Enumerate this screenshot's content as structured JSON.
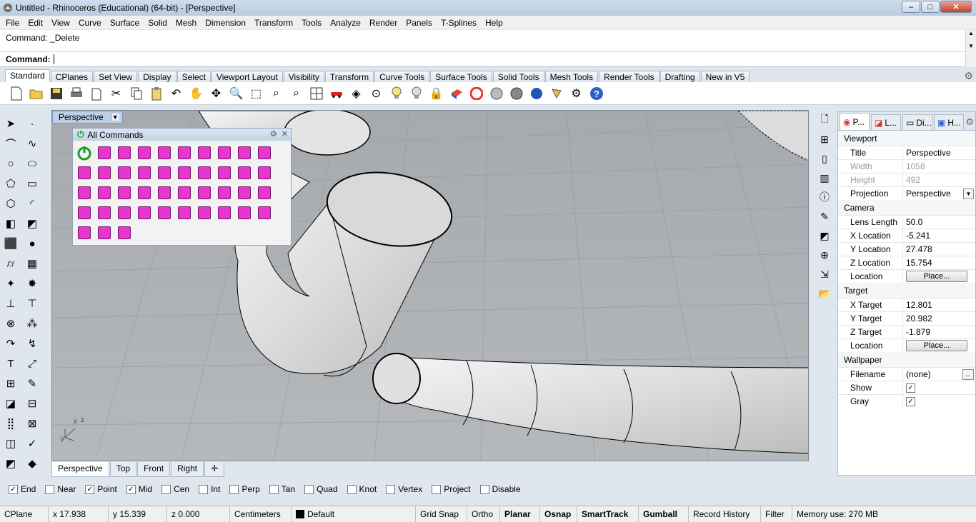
{
  "window": {
    "title": "Untitled - Rhinoceros (Educational) (64-bit) - [Perspective]",
    "min_label": "–",
    "max_label": "□",
    "close_label": "✕"
  },
  "menu": [
    "File",
    "Edit",
    "View",
    "Curve",
    "Surface",
    "Solid",
    "Mesh",
    "Dimension",
    "Transform",
    "Tools",
    "Analyze",
    "Render",
    "Panels",
    "T-Splines",
    "Help"
  ],
  "command": {
    "history": "Command: _Delete",
    "prompt": "Command:",
    "input_value": ""
  },
  "toolbar_tabs": [
    "Standard",
    "CPlanes",
    "Set View",
    "Display",
    "Select",
    "Viewport Layout",
    "Visibility",
    "Transform",
    "Curve Tools",
    "Surface Tools",
    "Solid Tools",
    "Mesh Tools",
    "Render Tools",
    "Drafting",
    "New in V5"
  ],
  "toolbar_icons": [
    "new-file-icon",
    "open-file-icon",
    "save-icon",
    "print-icon",
    "import-icon",
    "cut-icon",
    "copy-icon",
    "paste-icon",
    "undo-icon",
    "pan-hand-icon",
    "rotate-view-icon",
    "zoom-icon",
    "zoom-window-icon",
    "zoom-extents-icon",
    "zoom-selected-icon",
    "four-viewports-icon",
    "car-icon",
    "layer-icon",
    "snap-circle-icon",
    "light-icon",
    "bulb-icon",
    "lock-icon",
    "material-icon",
    "color-wheel-icon",
    "wireframe-sphere-icon",
    "shaded-sphere-icon",
    "blue-sphere-icon",
    "render-sphere-icon",
    "lamp-icon",
    "gear-options-icon",
    "help-icon"
  ],
  "viewport": {
    "title": "Perspective",
    "axis_x": "x",
    "axis_y": "y",
    "axis_z": "z"
  },
  "all_commands": {
    "title": "All Commands"
  },
  "view_tabs": [
    "Perspective",
    "Top",
    "Front",
    "Right"
  ],
  "properties": {
    "tabs": [
      "P...",
      "L...",
      "Di...",
      "H..."
    ],
    "viewport_section": "Viewport",
    "title_label": "Title",
    "title_value": "Perspective",
    "width_label": "Width",
    "width_value": "1058",
    "height_label": "Height",
    "height_value": "492",
    "projection_label": "Projection",
    "projection_value": "Perspective",
    "camera_section": "Camera",
    "lens_label": "Lens Length",
    "lens_value": "50.0",
    "xloc_label": "X Location",
    "xloc_value": "-5.241",
    "yloc_label": "Y Location",
    "yloc_value": "27.478",
    "zloc_label": "Z Location",
    "zloc_value": "15.754",
    "location_label": "Location",
    "place_button": "Place...",
    "target_section": "Target",
    "xt_label": "X Target",
    "xt_value": "12.801",
    "yt_label": "Y Target",
    "yt_value": "20.982",
    "zt_label": "Z Target",
    "zt_value": "-1.879",
    "tloc_label": "Location",
    "tplace_button": "Place...",
    "wallpaper_section": "Wallpaper",
    "filename_label": "Filename",
    "filename_value": "(none)",
    "show_label": "Show",
    "gray_label": "Gray"
  },
  "osnaps": [
    {
      "label": "End",
      "checked": true
    },
    {
      "label": "Near",
      "checked": false
    },
    {
      "label": "Point",
      "checked": true
    },
    {
      "label": "Mid",
      "checked": true
    },
    {
      "label": "Cen",
      "checked": false
    },
    {
      "label": "Int",
      "checked": false
    },
    {
      "label": "Perp",
      "checked": false
    },
    {
      "label": "Tan",
      "checked": false
    },
    {
      "label": "Quad",
      "checked": false
    },
    {
      "label": "Knot",
      "checked": false
    },
    {
      "label": "Vertex",
      "checked": false
    },
    {
      "label": "Project",
      "checked": false
    },
    {
      "label": "Disable",
      "checked": false
    }
  ],
  "status": {
    "cplane": "CPlane",
    "x": "x 17.938",
    "y": "y 15.339",
    "z": "z 0.000",
    "units": "Centimeters",
    "layer": "Default",
    "grid_snap": "Grid Snap",
    "ortho": "Ortho",
    "planar": "Planar",
    "osnap": "Osnap",
    "smarttrack": "SmartTrack",
    "gumball": "Gumball",
    "record_history": "Record History",
    "filter": "Filter",
    "memory": "Memory use: 270 MB"
  }
}
